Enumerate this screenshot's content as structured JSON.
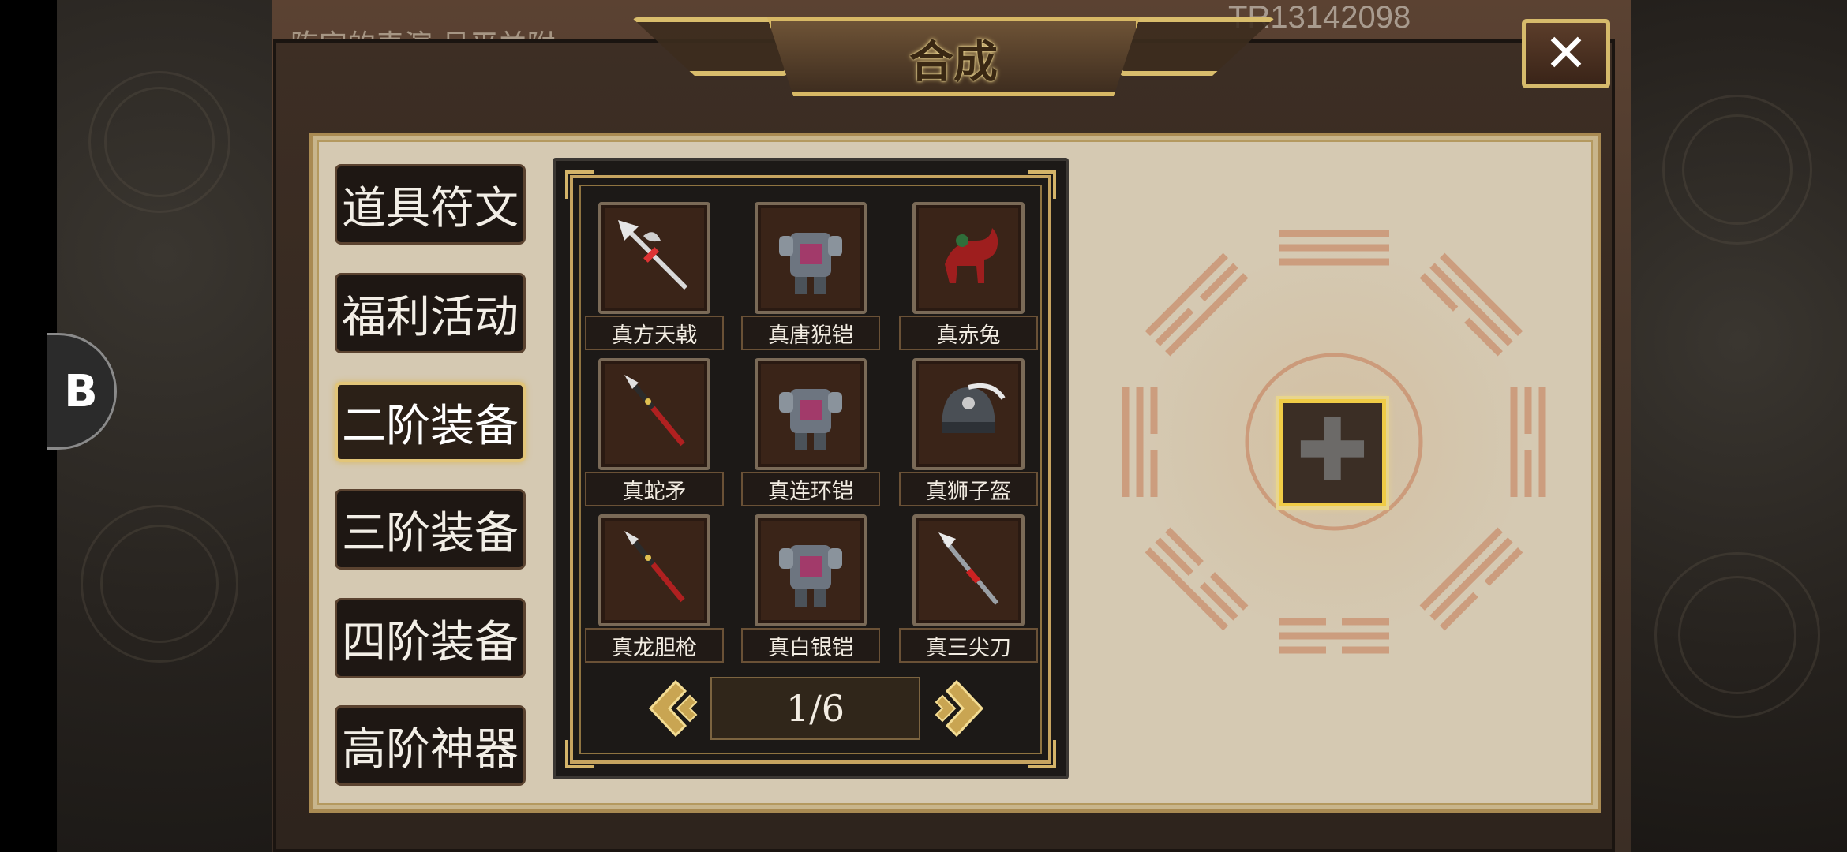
{
  "window": {
    "title": "合成",
    "close_label": "✕"
  },
  "overlay": {
    "marquee_text": "陈宫的表演 吕平并附",
    "trade_id": "TR13142098"
  },
  "float_widget": {
    "glyph": "B"
  },
  "categories": [
    {
      "label": "道具符文",
      "active": false
    },
    {
      "label": "福利活动",
      "active": false
    },
    {
      "label": "二阶装备",
      "active": true
    },
    {
      "label": "三阶装备",
      "active": false
    },
    {
      "label": "四阶装备",
      "active": false
    },
    {
      "label": "高阶神器",
      "active": false
    }
  ],
  "items": [
    {
      "name": "真方天戟",
      "icon": "halberd-icon"
    },
    {
      "name": "真唐猊铠",
      "icon": "armor-icon"
    },
    {
      "name": "真赤兔",
      "icon": "horse-icon"
    },
    {
      "name": "真蛇矛",
      "icon": "spear-icon"
    },
    {
      "name": "真连环铠",
      "icon": "armor-icon"
    },
    {
      "name": "真狮子盔",
      "icon": "helmet-icon"
    },
    {
      "name": "真龙胆枪",
      "icon": "spear-icon"
    },
    {
      "name": "真白银铠",
      "icon": "armor-icon"
    },
    {
      "name": "真三尖刀",
      "icon": "glaive-icon"
    }
  ],
  "pager": {
    "text": "1/6"
  },
  "craft": {
    "slot_icon": "plus-icon"
  },
  "colors": {
    "gold": "#d7b865",
    "highlight": "#f0cc46",
    "panel": "#d5c9b2"
  }
}
